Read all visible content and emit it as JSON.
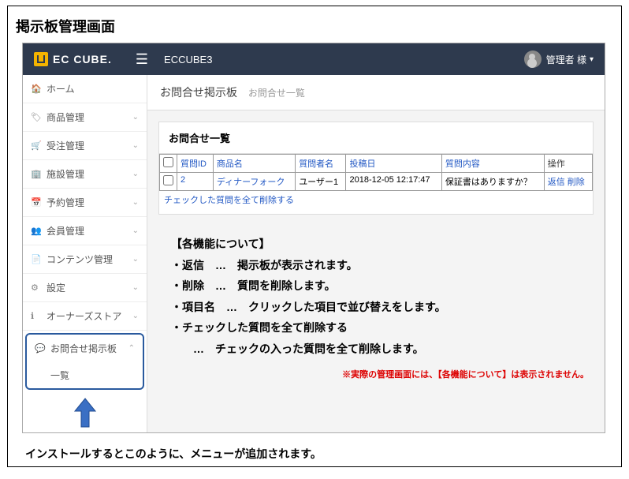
{
  "title": "掲示板管理画面",
  "logo": "EC CUBE.",
  "topnav_title": "ECCUBE3",
  "user": {
    "name": "管理者 様"
  },
  "sidebar": [
    {
      "icon": "🏠",
      "label": "ホーム",
      "expandable": false
    },
    {
      "icon": "🏷",
      "label": "商品管理",
      "expandable": true
    },
    {
      "icon": "🛒",
      "label": "受注管理",
      "expandable": true
    },
    {
      "icon": "🏢",
      "label": "施設管理",
      "expandable": true
    },
    {
      "icon": "📅",
      "label": "予約管理",
      "expandable": true
    },
    {
      "icon": "👥",
      "label": "会員管理",
      "expandable": true
    },
    {
      "icon": "📄",
      "label": "コンテンツ管理",
      "expandable": true
    },
    {
      "icon": "⚙",
      "label": "設定",
      "expandable": true
    },
    {
      "icon": "ℹ",
      "label": "オーナーズストア",
      "expandable": true
    }
  ],
  "highlight": {
    "icon": "💬",
    "label": "お問合せ掲示板",
    "sub": "一覧"
  },
  "breadcrumb": {
    "main": "お問合せ掲示板",
    "sub": "お問合せ一覧"
  },
  "panel": {
    "title": "お問合せ一覧"
  },
  "table": {
    "headers": [
      "",
      "質問ID",
      "商品名",
      "質問者名",
      "投稿日",
      "質問内容",
      "操作"
    ],
    "row": {
      "id": "2",
      "product": "ディナーフォーク",
      "author": "ユーザー1",
      "date": "2018-12-05 12:17:47",
      "content": "保証書はありますか？",
      "op_reply": "返信",
      "op_delete": "削除"
    },
    "delete_all": "チェックした質問を全て削除する"
  },
  "features": {
    "heading": "【各機能について】",
    "items": [
      "・返信　…　掲示板が表示されます。",
      "・削除　…　質問を削除します。",
      "・項目名　…　クリックした項目で並び替えをします。",
      "・チェックした質問を全て削除する",
      "　　…　チェックの入った質問を全て削除します。"
    ],
    "note": "※実際の管理画面には、【各機能について】は表示されません。"
  },
  "caption": "インストールするとこのように、メニューが追加されます。"
}
